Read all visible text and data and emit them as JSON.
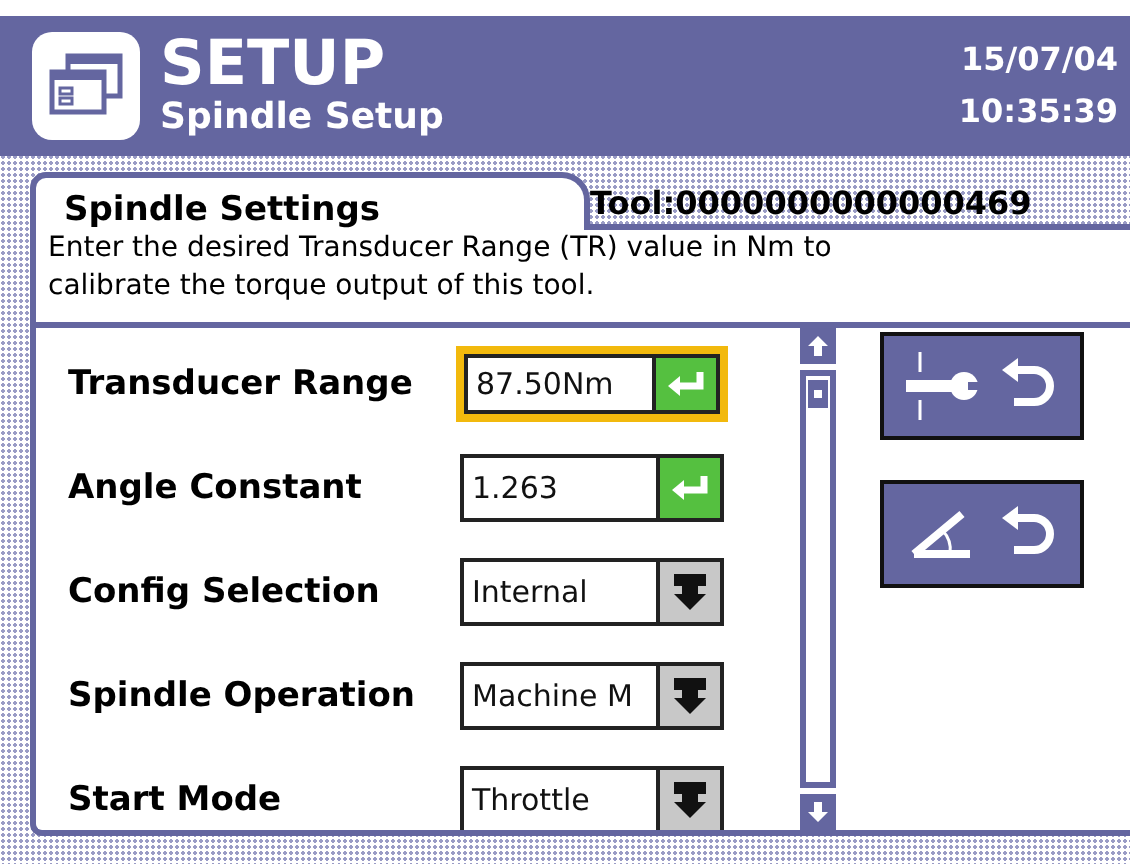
{
  "header": {
    "title": "SETUP",
    "subtitle": "Spindle Setup",
    "date": "15/07/04",
    "time": "10:35:39"
  },
  "tool_label": "Tool:0000000000000469",
  "panel": {
    "title": "Spindle Settings",
    "description": "Enter the desired Transducer Range (TR) value in Nm to calibrate the torque output of this tool."
  },
  "settings": [
    {
      "label": "Transducer Range",
      "kind": "input",
      "value": "87.50Nm",
      "selected": true
    },
    {
      "label": "Angle Constant",
      "kind": "input",
      "value": "1.263",
      "selected": false
    },
    {
      "label": "Config Selection",
      "kind": "dropdown",
      "value": "Internal",
      "selected": false
    },
    {
      "label": "Spindle Operation",
      "kind": "dropdown",
      "value": "Machine M",
      "selected": false
    },
    {
      "label": "Start Mode",
      "kind": "dropdown",
      "value": "Throttle",
      "selected": false
    }
  ]
}
